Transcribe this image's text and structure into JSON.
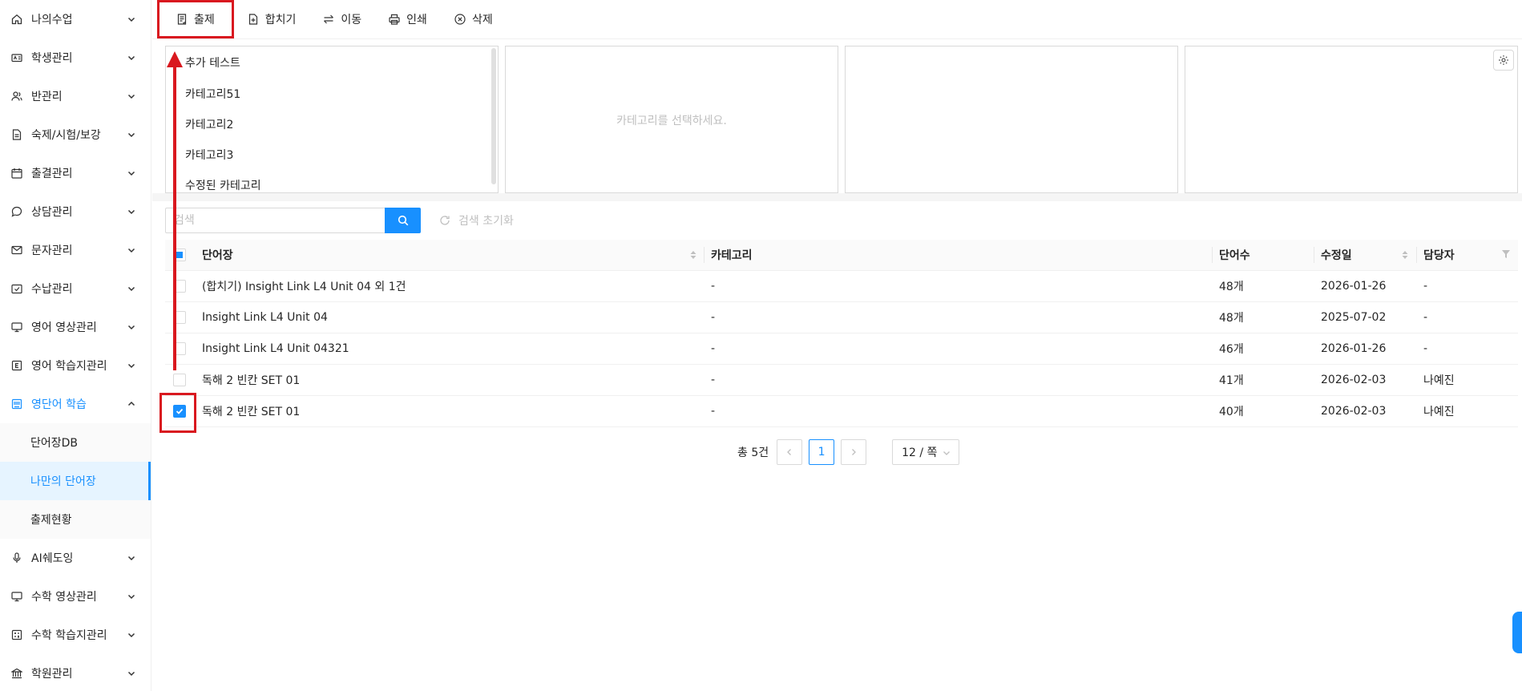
{
  "sidebar": {
    "items": [
      {
        "label": "나의수업"
      },
      {
        "label": "학생관리"
      },
      {
        "label": "반관리"
      },
      {
        "label": "숙제/시험/보강"
      },
      {
        "label": "출결관리"
      },
      {
        "label": "상담관리"
      },
      {
        "label": "문자관리"
      },
      {
        "label": "수납관리"
      },
      {
        "label": "영어 영상관리"
      },
      {
        "label": "영어 학습지관리"
      },
      {
        "label": "영단어 학습"
      },
      {
        "label": "AI쉐도잉"
      },
      {
        "label": "수학 영상관리"
      },
      {
        "label": "수학 학습지관리"
      },
      {
        "label": "학원관리"
      }
    ],
    "subitems": [
      {
        "label": "단어장DB"
      },
      {
        "label": "나만의 단어장"
      },
      {
        "label": "출제현황"
      }
    ]
  },
  "toolbar": {
    "buttons": [
      {
        "label": "출제"
      },
      {
        "label": "합치기"
      },
      {
        "label": "이동"
      },
      {
        "label": "인쇄"
      },
      {
        "label": "삭제"
      }
    ]
  },
  "categories": [
    {
      "label": "추가 테스트"
    },
    {
      "label": "카테고리51"
    },
    {
      "label": "카테고리2"
    },
    {
      "label": "카테고리3"
    },
    {
      "label": "수정된 카테고리"
    }
  ],
  "panel2": {
    "hint": "카테고리를 선택하세요."
  },
  "search": {
    "placeholder": "검색",
    "reset_label": "검색 초기화"
  },
  "table": {
    "columns": {
      "name": "단어장",
      "category": "카테고리",
      "count": "단어수",
      "date": "수정일",
      "manager": "담당자"
    },
    "rows": [
      {
        "name": "(합치기) Insight Link L4 Unit 04 외 1건",
        "category": "-",
        "count": "48개",
        "date": "2026-01-26",
        "manager": "-",
        "checked": false
      },
      {
        "name": "Insight Link L4 Unit 04",
        "category": "-",
        "count": "48개",
        "date": "2025-07-02",
        "manager": "-",
        "checked": false
      },
      {
        "name": "Insight Link L4 Unit 04321",
        "category": "-",
        "count": "46개",
        "date": "2026-01-26",
        "manager": "-",
        "checked": false
      },
      {
        "name": "독해 2 빈칸 SET 01",
        "category": "-",
        "count": "41개",
        "date": "2026-02-03",
        "manager": "나예진",
        "checked": false
      },
      {
        "name": "독해 2 빈칸 SET 01",
        "category": "-",
        "count": "40개",
        "date": "2026-02-03",
        "manager": "나예진",
        "checked": true
      }
    ]
  },
  "pagination": {
    "total": "총 5건",
    "current": "1",
    "page_size": "12 / 쪽"
  },
  "colors": {
    "accent": "#1890ff",
    "annotation": "#d9181f"
  }
}
